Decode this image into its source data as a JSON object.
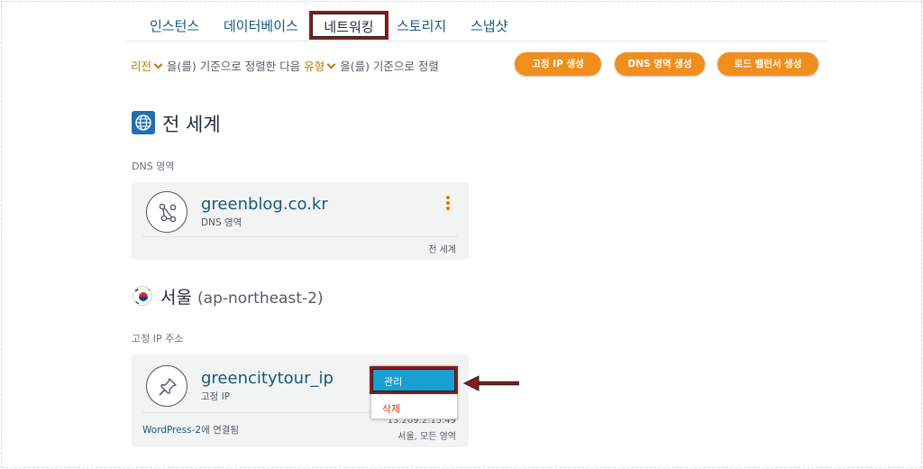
{
  "tabs": [
    {
      "label": "인스턴스"
    },
    {
      "label": "데이터베이스"
    },
    {
      "label": "네트워킹"
    },
    {
      "label": "스토리지"
    },
    {
      "label": "스냅샷"
    }
  ],
  "sort": {
    "first_value": "리전",
    "first_suffix": "을(를) 기준으로 정렬한 다음",
    "second_value": "유형",
    "second_suffix": "을(를) 기준으로 정렬"
  },
  "actions": {
    "static_ip": "고정 IP 생성",
    "dns_zone": "DNS 영역 생성",
    "load_balancer": "로드 밸런서 생성"
  },
  "global_section": {
    "heading": "전 세계",
    "label": "DNS 영역",
    "card": {
      "title": "greenblog.co.kr",
      "subtitle": "DNS 영역",
      "footer": "전 세계"
    }
  },
  "seoul_section": {
    "heading": "서울",
    "region_code": "(ap-northeast-2)",
    "label": "고정 IP 주소",
    "card": {
      "title": "greencitytour_ip",
      "subtitle": "고정 IP",
      "attached_name": "WordPress-2",
      "attached_suffix": "에 연결됨",
      "ip_address": "13.209.2.15.49",
      "location": "서울, 모든 영역"
    }
  },
  "menu": {
    "manage": "관리",
    "delete": "삭제"
  },
  "colors": {
    "accent_orange": "#f08f1e",
    "link_blue": "#16587a",
    "highlight_border": "#8b1a1a",
    "menu_selected": "#1a9fd0"
  }
}
